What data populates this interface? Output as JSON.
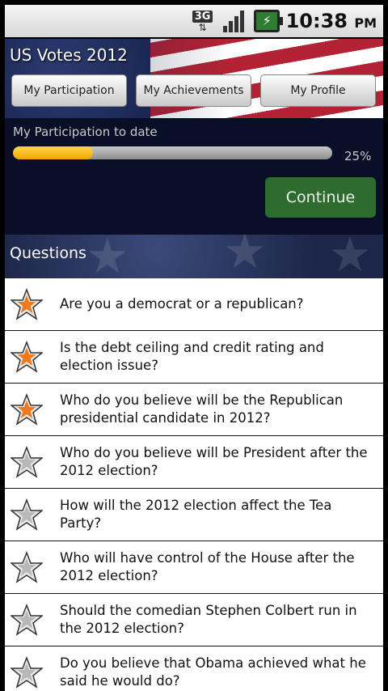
{
  "status_bar": {
    "network": "3G",
    "time": "10:38",
    "ampm": "PM",
    "icons": [
      "network-3g-icon",
      "signal-icon",
      "battery-charging-icon"
    ]
  },
  "app": {
    "title": "US Votes 2012",
    "tabs": [
      {
        "label": "My Participation"
      },
      {
        "label": "My Achievements"
      },
      {
        "label": "My Profile"
      }
    ]
  },
  "participation": {
    "label": "My Participation to date",
    "progress_percent": 25,
    "percent_text": "25%",
    "continue_label": "Continue"
  },
  "questions": {
    "header": "Questions",
    "items": [
      {
        "text": "Are you a democrat or a republican?",
        "answered": true
      },
      {
        "text": "Is the debt ceiling and credit rating and election issue?",
        "answered": true
      },
      {
        "text": "Who do you believe will be the Republican presidential candidate in 2012?",
        "answered": true
      },
      {
        "text": "Who do you believe will be President after the 2012 election?",
        "answered": false
      },
      {
        "text": "How will the 2012 election affect the Tea Party?",
        "answered": false
      },
      {
        "text": "Who will have control of the House after the 2012 election?",
        "answered": false
      },
      {
        "text": "Should the comedian Stephen Colbert run in the 2012 election?",
        "answered": false
      },
      {
        "text": "Do you believe that Obama achieved what he said he would do?",
        "answered": false
      }
    ]
  },
  "colors": {
    "accent_orange": "#f07a1a",
    "star_grey": "#b8b8b8",
    "progress_fill": "#f0a800",
    "continue_green": "#2e6b2f"
  }
}
